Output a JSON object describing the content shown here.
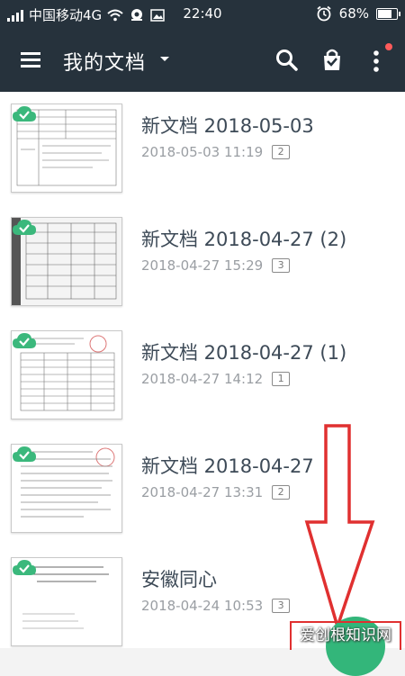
{
  "status_bar": {
    "carrier": "中国移动4G",
    "time": "22:40",
    "battery": "68%",
    "battery_level": 0.68
  },
  "app_bar": {
    "title": "我的文档",
    "icons": [
      "menu-icon",
      "caret-down-icon",
      "search-icon",
      "shopping-bag-icon",
      "more-vert-icon"
    ],
    "notification_dot_color": "#ff5b5b"
  },
  "documents": [
    {
      "title": "新文档 2018-05-03",
      "date": "2018-05-03 11:19",
      "pages": "2"
    },
    {
      "title": "新文档 2018-04-27 (2)",
      "date": "2018-04-27 15:29",
      "pages": "3"
    },
    {
      "title": "新文档 2018-04-27 (1)",
      "date": "2018-04-27 14:12",
      "pages": "1"
    },
    {
      "title": "新文档 2018-04-27",
      "date": "2018-04-27 13:31",
      "pages": "2"
    },
    {
      "title": "安徽同心",
      "date": "2018-04-24 10:53",
      "pages": "3"
    }
  ],
  "fab_color": "#33b67a",
  "watermark": "爱创根知识网",
  "colors": {
    "app_bar": "#26323c",
    "sync_ok": "#3bb87c",
    "annotation_red": "#e03030"
  }
}
